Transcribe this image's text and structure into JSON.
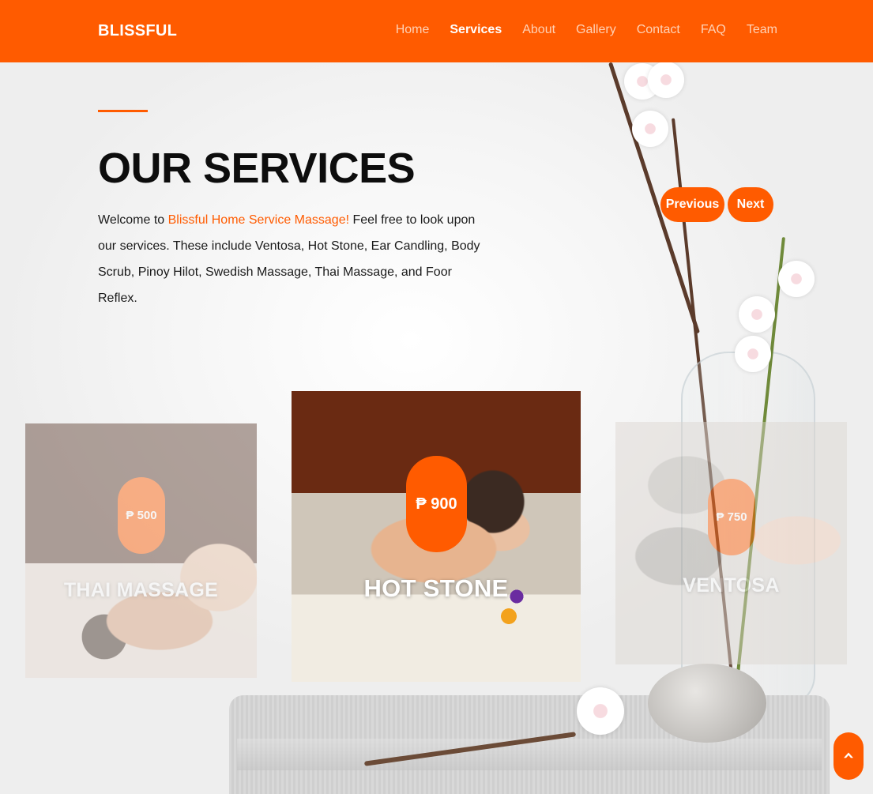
{
  "nav": {
    "brand": "BLISSFUL",
    "items": [
      {
        "label": "Home",
        "active": false
      },
      {
        "label": "Services",
        "active": true
      },
      {
        "label": "About",
        "active": false
      },
      {
        "label": "Gallery",
        "active": false
      },
      {
        "label": "Contact",
        "active": false
      },
      {
        "label": "FAQ",
        "active": false
      },
      {
        "label": "Team",
        "active": false
      }
    ]
  },
  "hero": {
    "title": "OUR SERVICES",
    "intro_prefix": "Welcome to ",
    "intro_highlight": "Blissful Home Service Massage!",
    "intro_suffix": " Feel free to look upon our services. These include Ventosa, Hot Stone, Ear Candling, Body Scrub, Pinoy Hilot, Swedish Massage, Thai Massage, and Foor Reflex."
  },
  "carousel": {
    "prev_label": "Previous",
    "next_label": "Next",
    "cards": [
      {
        "name": "THAI MASSAGE",
        "price": "₱ 500"
      },
      {
        "name": "HOT STONE",
        "price": "₱ 900"
      },
      {
        "name": "VENTOSA",
        "price": "₱ 750"
      }
    ]
  },
  "icons": {
    "back_to_top": "chevron-up-icon"
  },
  "colors": {
    "accent": "#ff5b00",
    "nav_inactive": "#ffd2b6",
    "text": "#111111"
  }
}
